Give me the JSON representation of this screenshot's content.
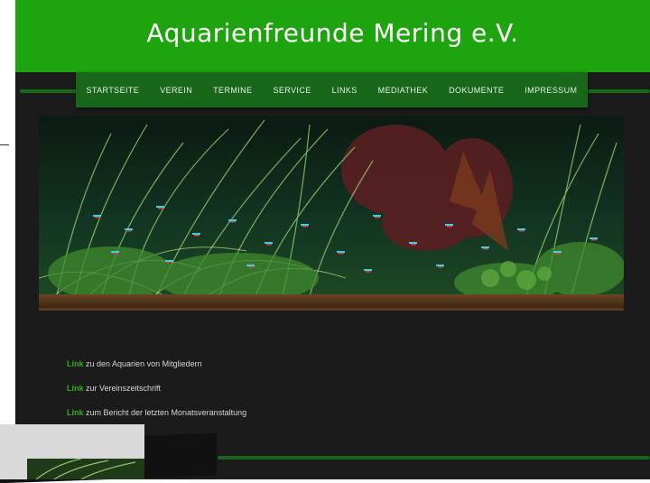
{
  "header": {
    "title": "Aquarienfreunde Mering e.V."
  },
  "nav": {
    "items": [
      "STARTSEITE",
      "VEREIN",
      "TERMINE",
      "SERVICE",
      "LINKS",
      "MEDIATHEK",
      "DOKUMENTE",
      "IMPRESSUM"
    ]
  },
  "links": [
    {
      "link": "Link",
      "text": " zu den Aquarien von Mitgliedern"
    },
    {
      "link": "Link",
      "text": " zur Vereinszeitschrift"
    },
    {
      "link": "Link",
      "text": " zum Bericht der letzten Monatsveranstaltung"
    }
  ],
  "colors": {
    "header_green": "#1ea40f",
    "nav_green": "#17661a",
    "background": "#1b1b1b",
    "link_green": "#2fae1d"
  }
}
